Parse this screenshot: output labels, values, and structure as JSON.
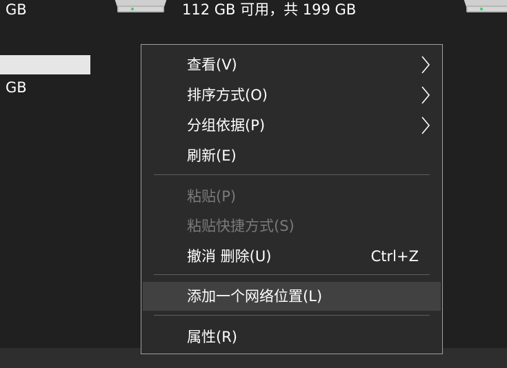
{
  "background": {
    "drive_top_left_text": "GB",
    "drive_top_center_text": "112 GB 可用，共 199 GB",
    "drive_second_left_text": "GB"
  },
  "menu": {
    "items": [
      {
        "label": "查看(V)",
        "submenu": true,
        "enabled": true
      },
      {
        "label": "排序方式(O)",
        "submenu": true,
        "enabled": true
      },
      {
        "label": "分组依据(P)",
        "submenu": true,
        "enabled": true
      },
      {
        "label": "刷新(E)",
        "submenu": false,
        "enabled": true
      },
      {
        "label": "粘贴(P)",
        "submenu": false,
        "enabled": false
      },
      {
        "label": "粘贴快捷方式(S)",
        "submenu": false,
        "enabled": false
      },
      {
        "label": "撤消 删除(U)",
        "shortcut": "Ctrl+Z",
        "submenu": false,
        "enabled": true
      },
      {
        "label": "添加一个网络位置(L)",
        "submenu": false,
        "enabled": true,
        "highlighted": true
      },
      {
        "label": "属性(R)",
        "submenu": false,
        "enabled": true
      }
    ]
  },
  "colors": {
    "background": "#202020",
    "menu_background": "#2b2b2b",
    "menu_border": "#a0a0a0",
    "hover": "#414141",
    "disabled_text": "#7a7a7a",
    "separator": "#5e5e5e"
  }
}
